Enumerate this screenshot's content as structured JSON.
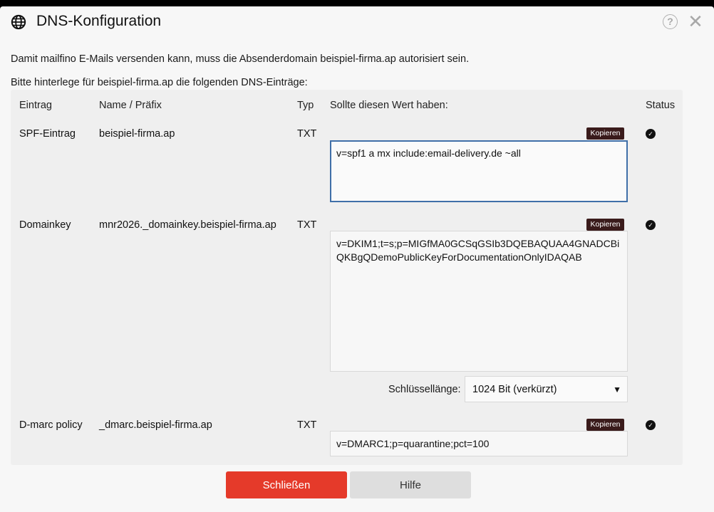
{
  "dialog": {
    "title": "DNS-Konfiguration",
    "intro_line1": "Damit mailfino E-Mails versenden kann, muss die Absenderdomain beispiel-firma.ap autorisiert sein.",
    "intro_line2": "Bitte hinterlege für beispiel-firma.ap die folgenden DNS-Einträge:",
    "help_icon_glyph": "?",
    "close_icon_glyph": "✕"
  },
  "table": {
    "headers": {
      "entry": "Eintrag",
      "name": "Name / Präfix",
      "type": "Typ",
      "value": "Sollte diesen Wert haben:",
      "status": "Status"
    },
    "copy_label": "Kopieren",
    "rows": [
      {
        "entry": "SPF-Eintrag",
        "name": "beispiel-firma.ap",
        "type": "TXT",
        "value": "v=spf1 a mx include:email-delivery.de ~all",
        "status_icon": "check-circle-icon"
      },
      {
        "entry": "Domainkey",
        "name": "mnr2026._domainkey.beispiel-firma.ap",
        "type": "TXT",
        "value": "v=DKIM1;t=s;p=MIGfMA0GCSqGSIb3DQEBAQUAA4GNADCBiQKBgQDemoPublicKeyForDocumentationOnlyIDAQAB",
        "status_icon": "check-circle-icon"
      },
      {
        "entry": "D-marc policy",
        "name": "_dmarc.beispiel-firma.ap",
        "type": "TXT",
        "value": "v=DMARC1;p=quarantine;pct=100",
        "status_icon": "check-circle-icon"
      }
    ],
    "key_length": {
      "label": "Schlüssellänge:",
      "selected": "1024 Bit (verkürzt)"
    }
  },
  "footer": {
    "close_label": "Schließen",
    "help_label": "Hilfe"
  },
  "colors": {
    "primary_button": "#e53a2a",
    "copy_badge": "#3a1b1b",
    "focus_border": "#3f6fa8"
  }
}
